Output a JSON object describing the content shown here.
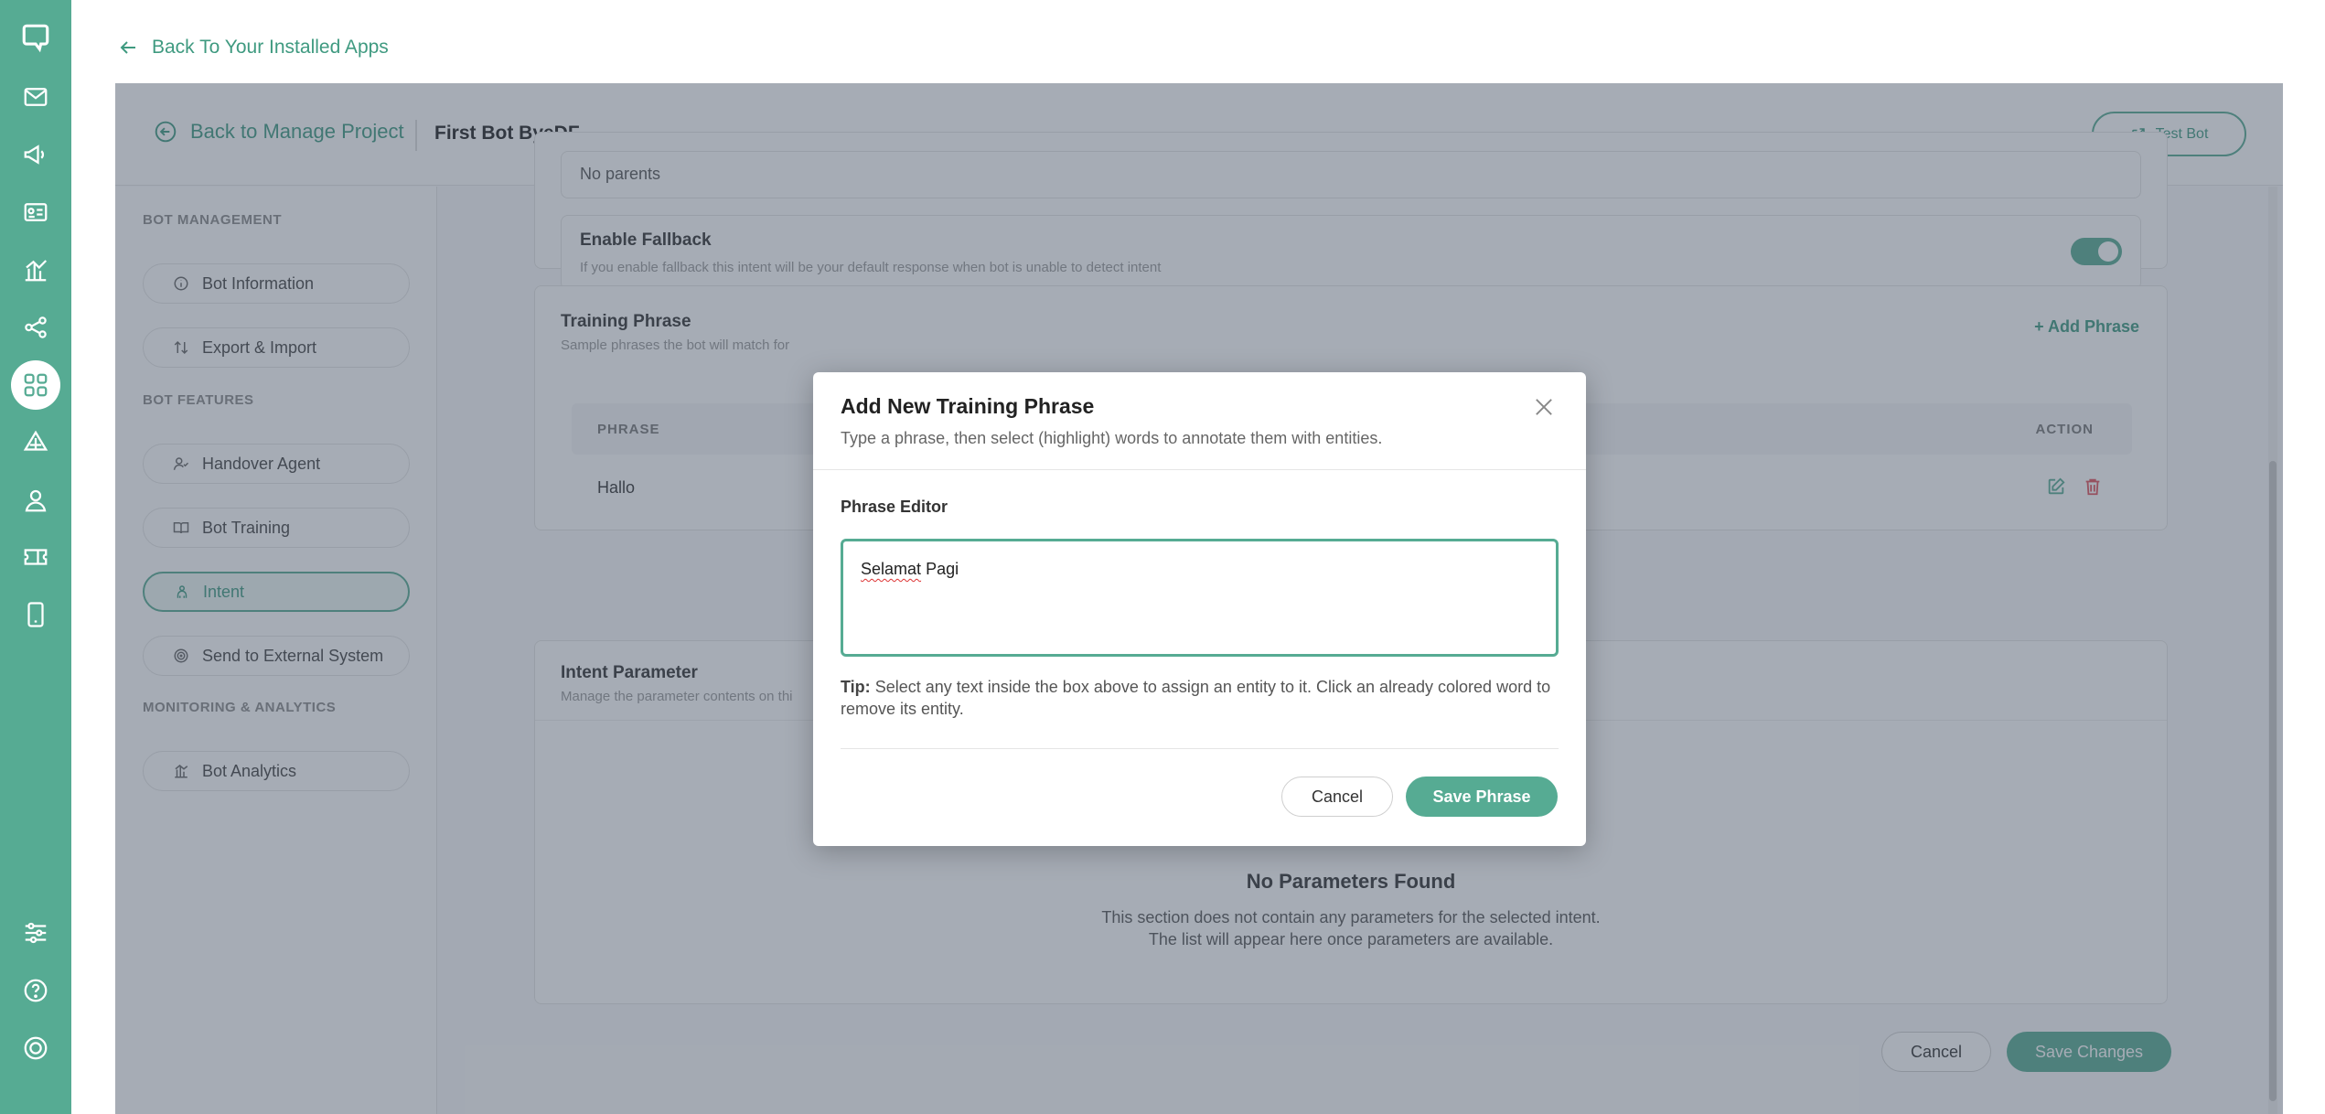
{
  "top_back": {
    "label": "Back To Your Installed Apps"
  },
  "header": {
    "back_label": "Back to Manage Project",
    "bot_name": "First Bot ByeDF",
    "test_bot_label": "Test Bot"
  },
  "rail": {
    "icons": [
      "chat-logo-icon",
      "mail-icon",
      "megaphone-icon",
      "contact-card-icon",
      "bar-chart-icon",
      "share-nodes-icon",
      "apps-grid-icon",
      "integration-icon",
      "user-agent-icon",
      "ticket-icon",
      "mobile-icon",
      "settings-sliders-icon",
      "help-icon",
      "power-icon"
    ],
    "active": "apps-grid-icon"
  },
  "sidebar": {
    "section_bot_management": "BOT MANAGEMENT",
    "bot_information": "Bot Information",
    "export_import": "Export & Import",
    "section_bot_features": "BOT FEATURES",
    "handover_agent": "Handover Agent",
    "bot_training": "Bot Training",
    "intent": "Intent",
    "send_external": "Send to External System",
    "section_monitoring": "MONITORING & ANALYTICS",
    "bot_analytics": "Bot Analytics"
  },
  "parent_field": {
    "value": "No parents"
  },
  "fallback": {
    "title": "Enable Fallback",
    "desc": "If you enable fallback this intent will be your default response when bot is unable to detect intent",
    "enabled": true
  },
  "training": {
    "title": "Training Phrase",
    "subtitle": "Sample phrases the bot will match for",
    "add_label": "+ Add Phrase",
    "col_phrase": "PHRASE",
    "col_action": "ACTION",
    "rows": [
      {
        "phrase": "Hallo"
      }
    ]
  },
  "parameter": {
    "title": "Intent Parameter",
    "subtitle": "Manage the parameter contents on thi",
    "empty_title": "No Parameters Found",
    "empty_line1": "This section does not contain any parameters for the selected intent.",
    "empty_line2": "The list will appear here once parameters are available."
  },
  "footer": {
    "cancel": "Cancel",
    "save": "Save Changes"
  },
  "modal": {
    "title": "Add New Training Phrase",
    "subtitle": "Type a phrase, then select (highlight) words to annotate them with entities.",
    "editor_label": "Phrase Editor",
    "editor_value_word1": "Selamat",
    "editor_value_word2": "Pagi",
    "tip_label": "Tip:",
    "tip_text": "Select any text inside the box above to assign an entity to it. Click an already colored word to remove its entity.",
    "cancel": "Cancel",
    "save": "Save Phrase"
  },
  "colors": {
    "accent": "#56ab93",
    "accent_dark": "#3f9a80",
    "danger": "#e0525b",
    "overlay": "rgba(70,82,100,0.48)"
  }
}
